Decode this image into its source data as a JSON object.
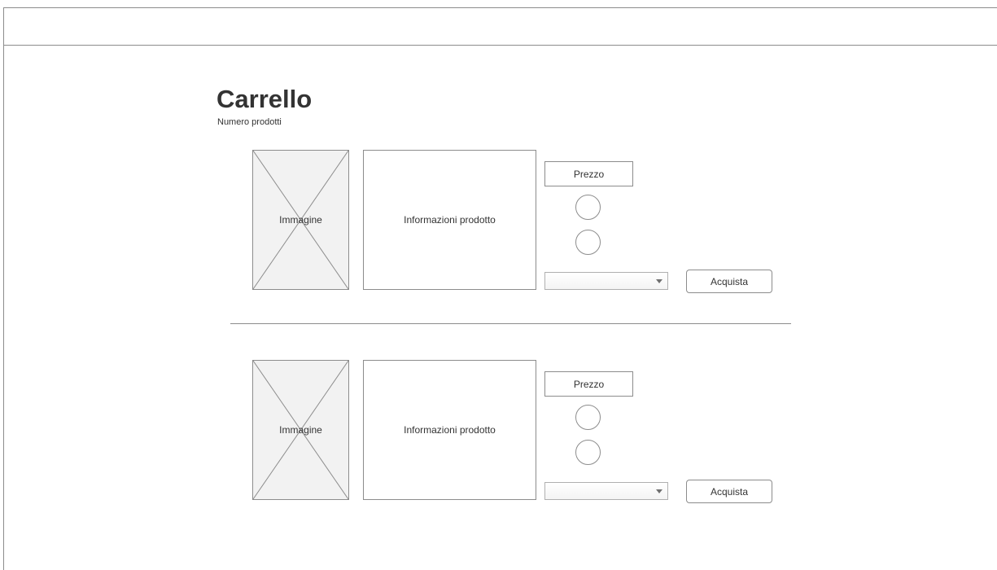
{
  "cart": {
    "title": "Carrello",
    "subtitle": "Numero prodotti"
  },
  "products": [
    {
      "image_label": "Immagine",
      "info_label": "Informazioni prodotto",
      "price_label": "Prezzo",
      "quantity_value": "",
      "buy_label": "Acquista"
    },
    {
      "image_label": "Immagine",
      "info_label": "Informazioni prodotto",
      "price_label": "Prezzo",
      "quantity_value": "",
      "buy_label": "Acquista"
    }
  ],
  "icons": {
    "select_arrow": "chevron-down-icon",
    "image_placeholder": "image-placeholder-icon"
  },
  "colors": {
    "border": "#8c8c8c",
    "placeholder_fill": "#f2f2f2",
    "text": "#333333"
  }
}
